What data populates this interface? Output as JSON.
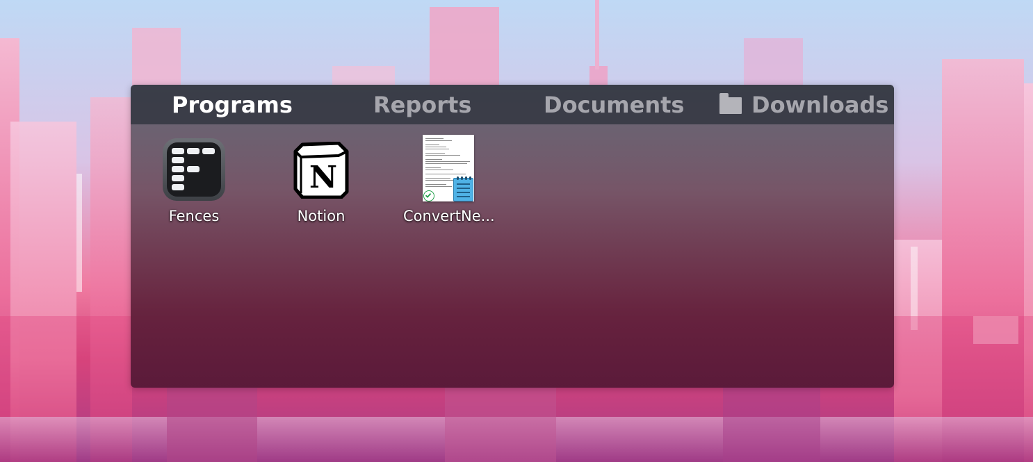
{
  "fence": {
    "tabs": [
      {
        "label": "Programs",
        "active": true
      },
      {
        "label": "Reports",
        "active": false
      },
      {
        "label": "Documents",
        "active": false
      },
      {
        "label": "Downloads",
        "active": false,
        "icon": "folder-icon"
      }
    ],
    "items": [
      {
        "label": "Fences",
        "icon": "fences-app-icon"
      },
      {
        "label": "Notion",
        "icon": "notion-app-icon"
      },
      {
        "label": "ConvertNe...",
        "icon": "text-document-thumbnail"
      }
    ]
  },
  "colors": {
    "tab_active": "#ffffff",
    "tab_inactive": "#a6a6ad",
    "tab_bar": "#343842",
    "fence_body": "#5c1e38"
  }
}
